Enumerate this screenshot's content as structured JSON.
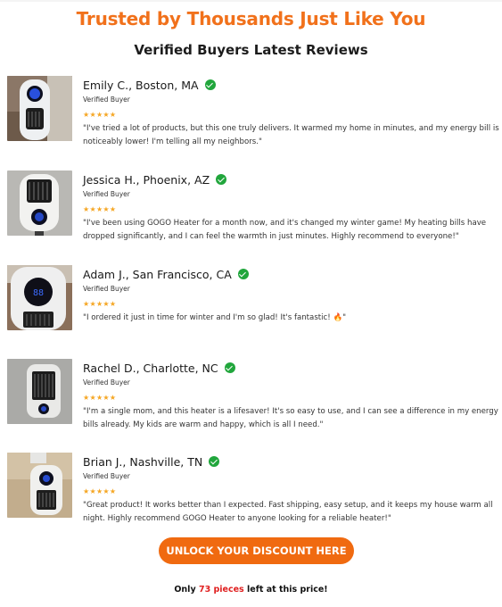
{
  "headline": "Trusted by Thousands Just Like You",
  "subheadline": "Verified Buyers Latest Reviews",
  "colors": {
    "accent": "#f1711b",
    "button": "#f06a10",
    "verified_check": "#21a63c",
    "stars": "#f5a623",
    "stock_count": "#e02020"
  },
  "reviews": [
    {
      "name": "Emily C., Boston, MA",
      "badge": "Verified Buyer",
      "stars": "★★★★★",
      "text": "\"I've tried a lot of products, but this one truly delivers. It warmed my home in minutes, and my energy bill is noticeably lower! I'm telling all my neighbors.\""
    },
    {
      "name": "Jessica H., Phoenix, AZ",
      "badge": "Verified Buyer",
      "stars": "★★★★★",
      "text": "\"I've been using GOGO Heater for a month now, and it's changed my winter game! My heating bills have dropped significantly, and I can feel the warmth in just minutes. Highly recommend to everyone!\""
    },
    {
      "name": "Adam J., San Francisco, CA",
      "badge": "Verified Buyer",
      "stars": "★★★★★",
      "text": "\"I ordered it just in time for winter and I'm so glad! It's fantastic! 🔥\""
    },
    {
      "name": "Rachel D., Charlotte, NC",
      "badge": "Verified Buyer",
      "stars": "★★★★★",
      "text": "\"I'm a single mom, and this heater is a lifesaver! It's so easy to use, and I can see a difference in my energy bills already. My kids are warm and happy, which is all I need.\""
    },
    {
      "name": "Brian J., Nashville, TN",
      "badge": "Verified Buyer",
      "stars": "★★★★★",
      "text": "\"Great product! It works better than I expected. Fast shipping, easy setup, and it keeps my house warm all night. Highly recommend GOGO Heater to anyone looking for a reliable heater!\""
    }
  ],
  "cta": {
    "label": "UNLOCK YOUR DISCOUNT HERE"
  },
  "stock": {
    "prefix": "Only ",
    "count": "73 pieces",
    "suffix": " left at this price!"
  }
}
